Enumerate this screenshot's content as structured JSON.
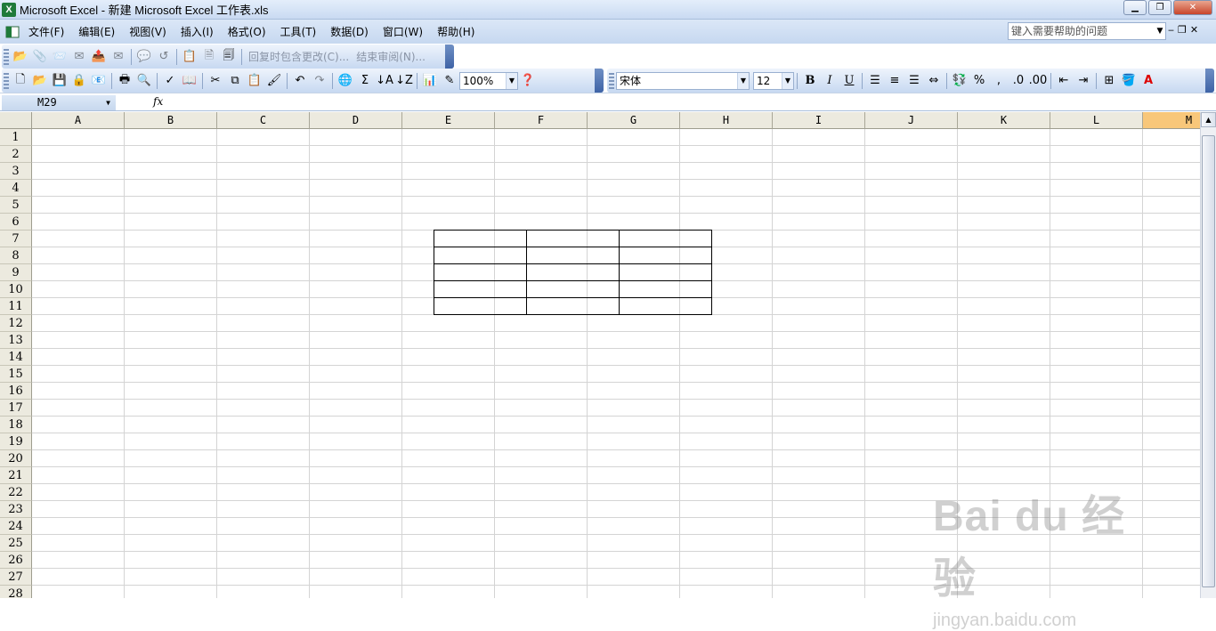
{
  "window": {
    "title": "Microsoft Excel - 新建 Microsoft Excel 工作表.xls",
    "app_icon": "X",
    "controls": [
      "minimize-icon",
      "restore-icon",
      "close-icon"
    ]
  },
  "menu": {
    "items": [
      "文件(F)",
      "编辑(E)",
      "视图(V)",
      "插入(I)",
      "格式(O)",
      "工具(T)",
      "数据(D)",
      "窗口(W)",
      "帮助(H)"
    ],
    "help_placeholder": "键入需要帮助的问题"
  },
  "review_toolbar": {
    "reply_with_changes": "回复时包含更改(C)...",
    "end_review": "结束审阅(N)..."
  },
  "standard_toolbar": {
    "zoom": "100%"
  },
  "format_toolbar": {
    "font_name": "宋体",
    "font_size": "12",
    "bold": "B",
    "italic": "I",
    "underline": "U",
    "percent": "%",
    "comma": ","
  },
  "formula_bar": {
    "name_box": "M29",
    "fx_label": "fx",
    "formula": ""
  },
  "sheet": {
    "columns": [
      "A",
      "B",
      "C",
      "D",
      "E",
      "F",
      "G",
      "H",
      "I",
      "J",
      "K",
      "L",
      "M"
    ],
    "selected_column": "M",
    "rows": [
      "1",
      "2",
      "3",
      "4",
      "5",
      "6",
      "7",
      "8",
      "9",
      "10",
      "11",
      "12",
      "13",
      "14",
      "15",
      "16",
      "17",
      "18",
      "19",
      "20",
      "21",
      "22",
      "23",
      "24",
      "25",
      "26",
      "27",
      "28"
    ],
    "bordered_range": "E6:G10"
  },
  "watermark": {
    "main": "Bai du 经验",
    "sub": "jingyan.baidu.com"
  },
  "colors": {
    "selected_header": "#f8c77a",
    "toolbar_blue": "#c7d9f1"
  }
}
